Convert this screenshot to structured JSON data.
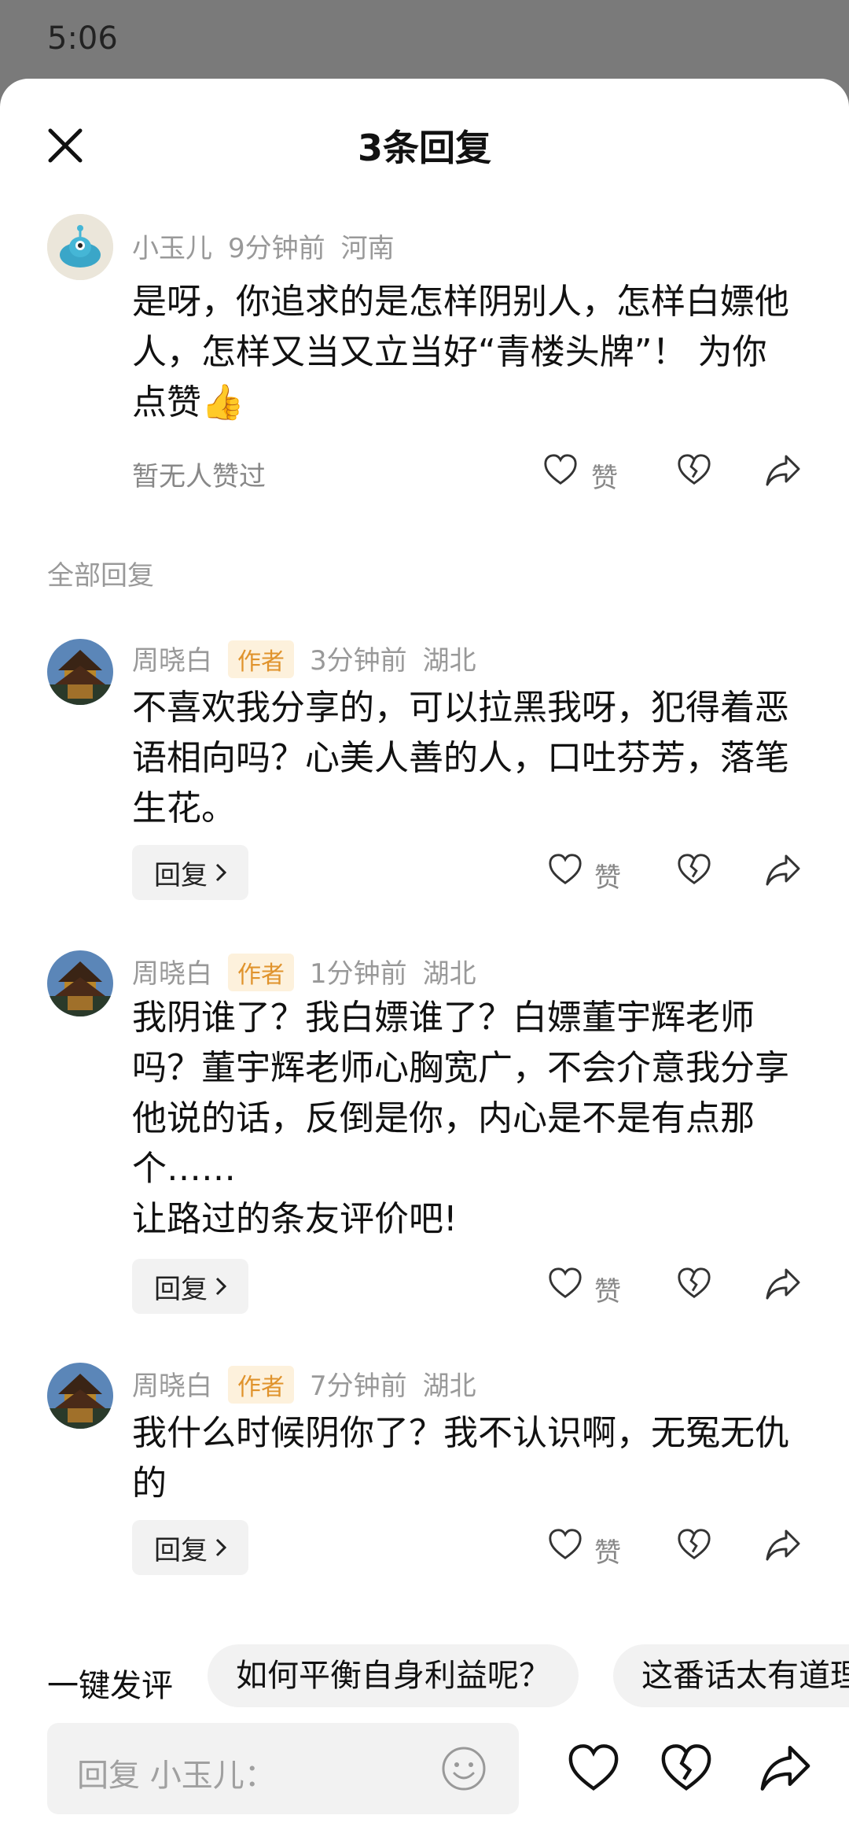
{
  "status_bar": {
    "time": "5:06"
  },
  "header": {
    "title": "3条回复"
  },
  "main_comment": {
    "username": "小玉儿",
    "time": "9分钟前",
    "location": "河南",
    "text": "是呀，你追求的是怎样阴别人，怎样白嫖他人，怎样又当又立当好“青楼头牌”！ 为你点赞👍",
    "no_likes": "暂无人赞过",
    "like_label": "赞"
  },
  "section": {
    "all_replies": "全部回复"
  },
  "replies": [
    {
      "username": "周晓白",
      "tag": "作者",
      "time": "3分钟前",
      "location": "湖北",
      "text": "不喜欢我分享的，可以拉黑我呀，犯得着恶语相向吗？心美人善的人，口吐芬芳，落笔生花。",
      "reply_label": "回复",
      "like_label": "赞"
    },
    {
      "username": "周晓白",
      "tag": "作者",
      "time": "1分钟前",
      "location": "湖北",
      "text": "我阴谁了？我白嫖谁了？白嫖董宇辉老师吗？董宇辉老师心胸宽广，不会介意我分享他说的话，反倒是你，内心是不是有点那个……\n让路过的条友评价吧!",
      "reply_label": "回复",
      "like_label": "赞"
    },
    {
      "username": "周晓白",
      "tag": "作者",
      "time": "7分钟前",
      "location": "湖北",
      "text": "我什么时候阴你了？我不认识啊，无冤无仇的",
      "reply_label": "回复",
      "like_label": "赞"
    }
  ],
  "quick_comment": {
    "label": "一键发评",
    "chips": [
      "如何平衡自身利益呢？",
      "这番话太有道理"
    ]
  },
  "input": {
    "placeholder": "回复 小玉儿："
  },
  "icons": [
    "close-icon",
    "heart-icon",
    "broken-heart-icon",
    "share-icon",
    "emoji-icon",
    "chevron-right-icon"
  ]
}
